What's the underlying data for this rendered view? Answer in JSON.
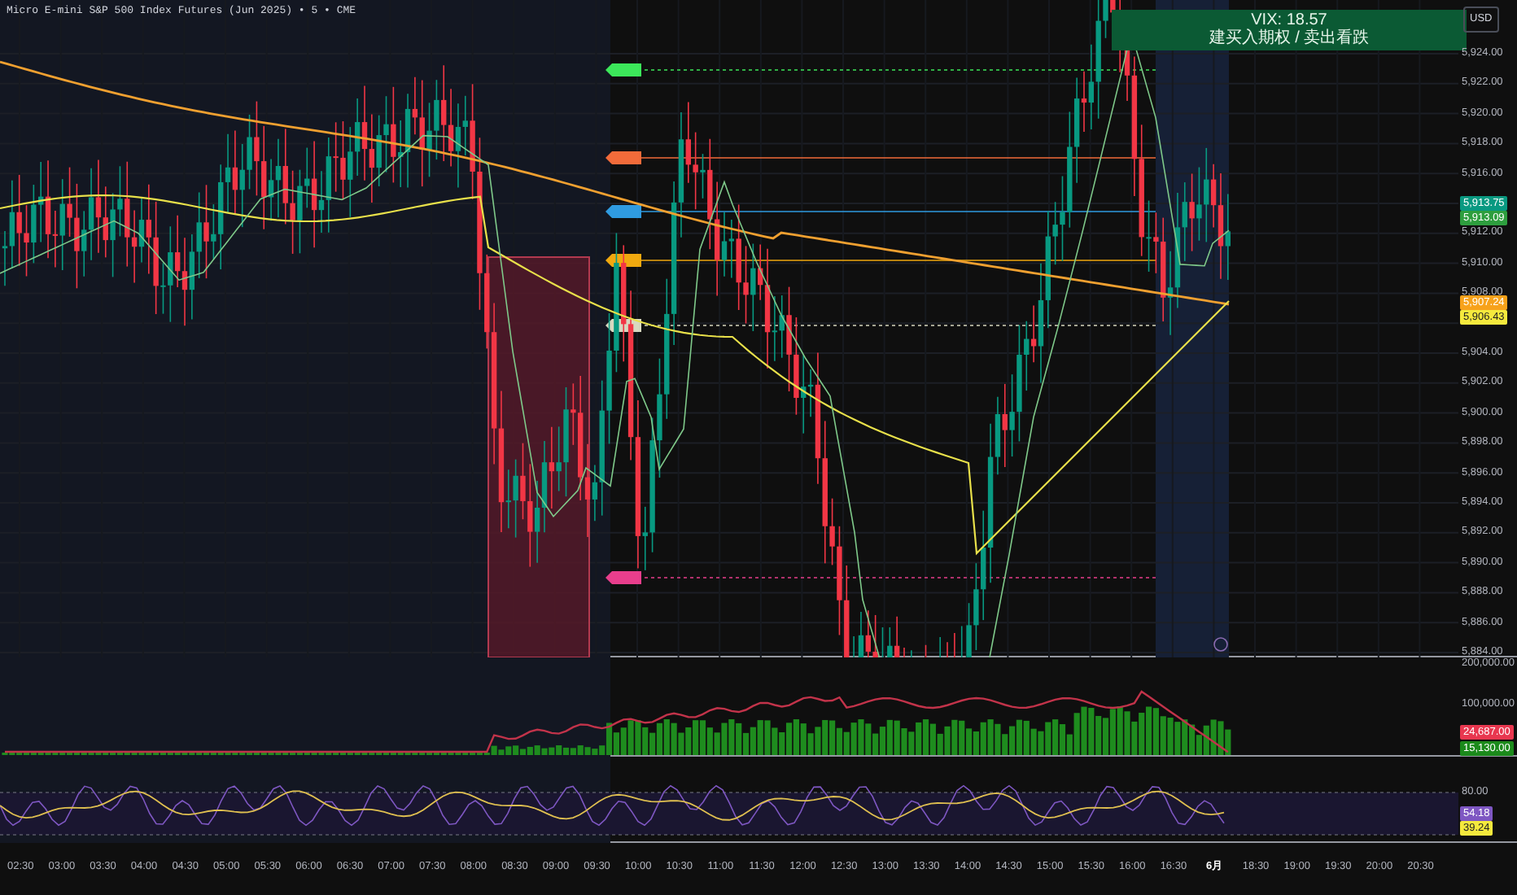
{
  "title": "Micro E-mini S&P 500 Index Futures (Jun 2025) • 5 • CME",
  "vix_panel": {
    "line_1": "VIX: 18.57",
    "line_2": "建买入期权 / 卖出看跌"
  },
  "currency": "USD",
  "price_axis": [
    "5,924.00",
    "5,922.00",
    "5,920.00",
    "5,918.00",
    "5,916.00",
    "5,912.00",
    "5,910.00",
    "5,908.00",
    "5,904.00",
    "5,902.00",
    "5,900.00",
    "5,898.00",
    "5,896.00",
    "5,894.00",
    "5,892.00",
    "5,890.00",
    "5,888.00",
    "5,886.00",
    "5,884.00"
  ],
  "price_badges": [
    {
      "text": "5,913.75",
      "color": "#089981"
    },
    {
      "text": "5,913.09",
      "color": "#2e9e3e"
    },
    {
      "text": "5,907.24",
      "color": "#f7a21b"
    },
    {
      "text": "5,906.43",
      "color": "#f5e93d"
    }
  ],
  "volume_axis": [
    "200,000.00",
    "100,000.00"
  ],
  "volume_badges": [
    {
      "text": "24,687.00",
      "color": "#e8374f"
    },
    {
      "text": "15,130.00",
      "color": "#1b8a1b"
    }
  ],
  "oscillator_axis": [
    "80.00"
  ],
  "oscillator_badges": [
    {
      "text": "54.18",
      "color": "#7e57c2"
    },
    {
      "text": "39.24",
      "color": "#f5e93d"
    }
  ],
  "time_axis": [
    {
      "label": "02:30",
      "bold": false
    },
    {
      "label": "03:00",
      "bold": false
    },
    {
      "label": "03:30",
      "bold": false
    },
    {
      "label": "04:00",
      "bold": false
    },
    {
      "label": "04:30",
      "bold": false
    },
    {
      "label": "05:00",
      "bold": false
    },
    {
      "label": "05:30",
      "bold": false
    },
    {
      "label": "06:00",
      "bold": false
    },
    {
      "label": "06:30",
      "bold": false
    },
    {
      "label": "07:00",
      "bold": false
    },
    {
      "label": "07:30",
      "bold": false
    },
    {
      "label": "08:00",
      "bold": false
    },
    {
      "label": "08:30",
      "bold": false
    },
    {
      "label": "09:00",
      "bold": false
    },
    {
      "label": "09:30",
      "bold": false
    },
    {
      "label": "10:00",
      "bold": false
    },
    {
      "label": "10:30",
      "bold": false
    },
    {
      "label": "11:00",
      "bold": false
    },
    {
      "label": "11:30",
      "bold": false
    },
    {
      "label": "12:00",
      "bold": false
    },
    {
      "label": "12:30",
      "bold": false
    },
    {
      "label": "13:00",
      "bold": false
    },
    {
      "label": "13:30",
      "bold": false
    },
    {
      "label": "14:00",
      "bold": false
    },
    {
      "label": "14:30",
      "bold": false
    },
    {
      "label": "15:00",
      "bold": false
    },
    {
      "label": "15:30",
      "bold": false
    },
    {
      "label": "16:00",
      "bold": false
    },
    {
      "label": "16:30",
      "bold": false
    },
    {
      "label": "6月",
      "bold": true
    },
    {
      "label": "18:30",
      "bold": false
    },
    {
      "label": "19:00",
      "bold": false
    },
    {
      "label": "19:30",
      "bold": false
    },
    {
      "label": "20:00",
      "bold": false
    },
    {
      "label": "20:30",
      "bold": false
    }
  ]
}
